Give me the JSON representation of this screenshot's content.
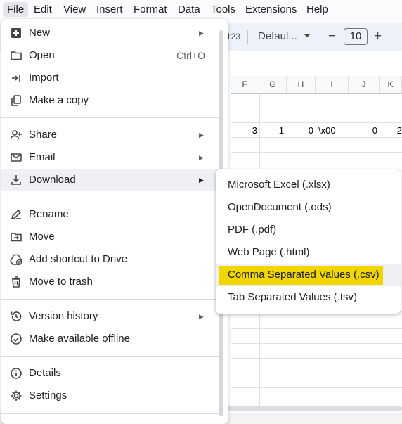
{
  "menubar": {
    "items": [
      {
        "label": "File"
      },
      {
        "label": "Edit"
      },
      {
        "label": "View"
      },
      {
        "label": "Insert"
      },
      {
        "label": "Format"
      },
      {
        "label": "Data"
      },
      {
        "label": "Tools"
      },
      {
        "label": "Extensions"
      },
      {
        "label": "Help"
      }
    ]
  },
  "toolbar": {
    "number_format": "123",
    "font_name": "Defaul...",
    "font_size": "10",
    "decrease_symbol": "−",
    "increase_symbol": "+"
  },
  "sheet": {
    "columns": [
      "F",
      "G",
      "H",
      "I",
      "J",
      "K"
    ],
    "row_values": [
      "3",
      "-1",
      "0",
      "\\x00",
      "0",
      "-2"
    ]
  },
  "file_menu": {
    "items": [
      {
        "label": "New",
        "icon": "plus-square-icon",
        "submenu": true
      },
      {
        "label": "Open",
        "icon": "folder-icon",
        "shortcut": "Ctrl+O"
      },
      {
        "label": "Import",
        "icon": "import-arrow-icon"
      },
      {
        "label": "Make a copy",
        "icon": "copy-icon"
      },
      {
        "label": "Share",
        "icon": "person-add-icon",
        "submenu": true
      },
      {
        "label": "Email",
        "icon": "mail-icon",
        "submenu": true
      },
      {
        "label": "Download",
        "icon": "download-icon",
        "submenu": true,
        "highlighted": true
      },
      {
        "label": "Rename",
        "icon": "rename-pencil-icon"
      },
      {
        "label": "Move",
        "icon": "folder-move-icon"
      },
      {
        "label": "Add shortcut to Drive",
        "icon": "drive-shortcut-icon"
      },
      {
        "label": "Move to trash",
        "icon": "trash-icon"
      },
      {
        "label": "Version history",
        "icon": "history-icon",
        "submenu": true
      },
      {
        "label": "Make available offline",
        "icon": "offline-check-icon"
      },
      {
        "label": "Details",
        "icon": "info-icon"
      },
      {
        "label": "Settings",
        "icon": "gear-icon"
      }
    ],
    "submenu_arrow": "▶"
  },
  "download_menu": {
    "items": [
      {
        "label": "Microsoft Excel (.xlsx)"
      },
      {
        "label": "OpenDocument (.ods)"
      },
      {
        "label": "PDF (.pdf)"
      },
      {
        "label": "Web Page (.html)"
      },
      {
        "label": "Comma Separated Values (.csv)",
        "highlighted": true
      },
      {
        "label": "Tab Separated Values (.tsv)"
      }
    ]
  },
  "colors": {
    "highlight_yellow": "#f2d600",
    "menu_hover": "#eef0f3",
    "toolbar_bg": "#edf2fa"
  }
}
